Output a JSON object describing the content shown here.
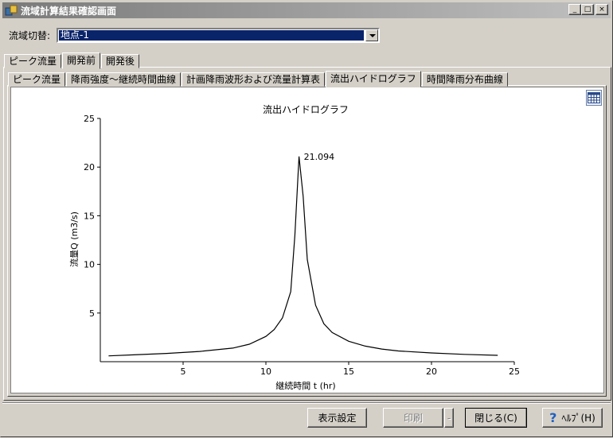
{
  "window": {
    "title": "流域計算結果確認画面",
    "controls": [
      "_",
      "□",
      "×"
    ]
  },
  "region": {
    "label": "流域切替:",
    "value": "地点-1"
  },
  "outer_tabs": [
    {
      "label": "ピーク流量",
      "active": false
    },
    {
      "label": "開発前",
      "active": true
    },
    {
      "label": "開発後",
      "active": false
    }
  ],
  "inner_tabs": [
    {
      "label": "ピーク流量",
      "active": false
    },
    {
      "label": "降雨強度～継続時間曲線",
      "active": false
    },
    {
      "label": "計画降雨波形および流量計算表",
      "active": false
    },
    {
      "label": "流出ハイドログラフ",
      "active": true
    },
    {
      "label": "時間降雨分布曲線",
      "active": false
    }
  ],
  "chart_data": {
    "type": "line",
    "title": "流出ハイドログラフ",
    "xlabel": "継続時間 t (hr)",
    "ylabel": "流量Q (m3/s)",
    "xlim": [
      0,
      25
    ],
    "ylim": [
      0,
      25
    ],
    "xticks": [
      5,
      10,
      15,
      20,
      25
    ],
    "yticks": [
      5,
      10,
      15,
      20,
      25
    ],
    "peak_label": "21.094",
    "peak": {
      "x": 12,
      "y": 21.094
    },
    "series": [
      {
        "x": [
          0.5,
          2,
          4,
          6,
          8,
          9,
          10,
          10.5,
          11,
          11.5,
          11.75,
          12,
          12.25,
          12.5,
          13,
          13.5,
          14,
          15,
          16,
          17,
          18,
          20,
          22,
          24
        ],
        "y": [
          0.6,
          0.7,
          0.85,
          1.05,
          1.4,
          1.8,
          2.6,
          3.3,
          4.5,
          7.2,
          13.0,
          21.094,
          17.0,
          10.5,
          5.8,
          3.9,
          3.0,
          2.1,
          1.6,
          1.3,
          1.1,
          0.9,
          0.75,
          0.65
        ]
      }
    ]
  },
  "buttons": {
    "display_settings": "表示設定",
    "print": "印刷",
    "print_dropdown": "-",
    "close": "閉じる(C)",
    "help": "ﾍﾙﾌﾟ(H)",
    "help_icon": "?"
  },
  "colors": {
    "selection": "#0a246a",
    "line": "#000000"
  }
}
